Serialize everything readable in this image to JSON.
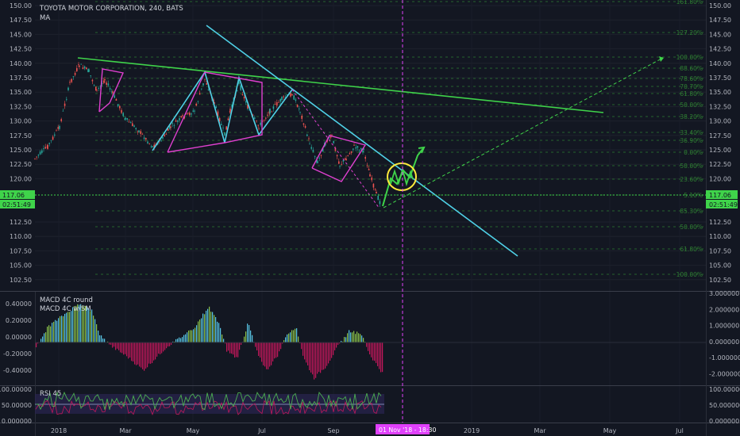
{
  "header": {
    "title": "TOYOTA MOTOR CORPORATION, 240, BATS",
    "indicator": "MA"
  },
  "price_axis": {
    "ticks": [
      "150.00",
      "147.50",
      "145.00",
      "142.50",
      "140.00",
      "137.50",
      "135.00",
      "132.50",
      "130.00",
      "127.50",
      "125.00",
      "122.50",
      "120.00",
      "117.06",
      "02:51:49",
      "112.50",
      "110.00",
      "107.50",
      "105.00",
      "102.50"
    ],
    "current_price": "117.06",
    "countdown": "02:51:49"
  },
  "fib_levels": [
    "161.80%",
    "127.20%",
    "100.00%",
    "88.60%",
    "78.60%",
    "70.70%",
    "61.80%",
    "50.00%",
    "38.20%",
    "33.40%",
    "36.90%",
    "0.00%",
    "50.00%",
    "23.60%",
    "5.10%",
    "85.30%",
    "50.00%",
    "61.80%",
    "100.00%"
  ],
  "macd": {
    "legend1": "MACD 4C round",
    "legend2": "MACD 4C w/SM",
    "left_ticks": [
      "0.40000",
      "0.20000",
      "0.00000",
      "-0.20000",
      "-0.40000"
    ],
    "right_ticks": [
      "3.000000",
      "2.000000",
      "1.000000",
      "0.000000",
      "-1.000000",
      "-2.000000"
    ]
  },
  "rsi": {
    "legend": "RSI 45",
    "left_ticks": [
      "100.00000",
      "50.00000",
      "0.000000"
    ],
    "right_ticks": [
      "100.000000",
      "50.000000",
      "0.000000"
    ]
  },
  "time_axis": {
    "labels": [
      "2018",
      "Mar",
      "May",
      "Jul",
      "Sep",
      "2019",
      "Mar",
      "May",
      "Jul"
    ],
    "cursor_label": "01 Nov '18 - 18:30"
  },
  "colors": {
    "background": "#131722",
    "trendline_green": "#3fd34a",
    "trendline_cyan": "#4fd0e6",
    "pattern_magenta": "#e040d0",
    "fib_green": "#2e7d32",
    "macd_up": "#59c6e6",
    "macd_down": "#c2185b",
    "rsi_line": "#4caf50",
    "highlight_circle": "#ffeb3b",
    "cursor": "#e040fb"
  },
  "chart_data": {
    "type": "line",
    "title": "TOYOTA MOTOR CORPORATION, 240, BATS",
    "ylim": [
      101,
      151
    ],
    "x": [
      "2018-01",
      "2018-02",
      "2018-03",
      "2018-04",
      "2018-05",
      "2018-06",
      "2018-07",
      "2018-08",
      "2018-09",
      "2018-10",
      "2018-11"
    ],
    "series": [
      {
        "values": [
          124,
          141,
          132,
          126,
          138,
          129,
          135,
          125,
          122,
          119,
          115
        ]
      }
    ]
  }
}
